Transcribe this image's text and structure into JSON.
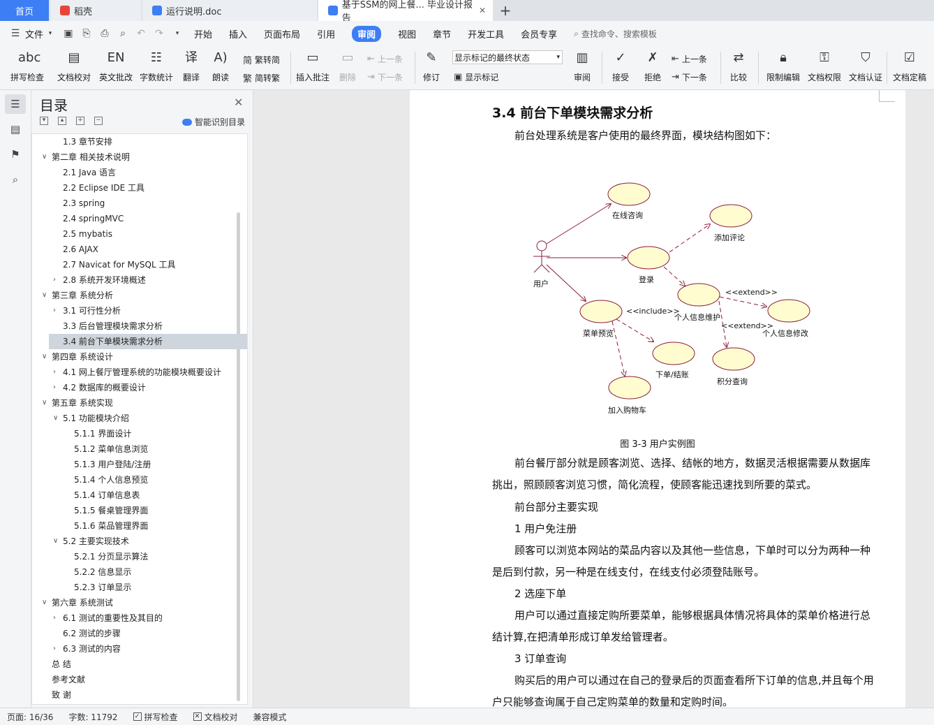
{
  "tabs": {
    "home": "首页",
    "t1": "稻壳",
    "t2": "运行说明.doc",
    "t3": "基于SSM的网上餐... 毕业设计报告",
    "plus": "+"
  },
  "menu": {
    "file": "文件",
    "items": [
      "开始",
      "插入",
      "页面布局",
      "引用",
      "审阅",
      "视图",
      "章节",
      "开发工具",
      "会员专享"
    ],
    "active": "审阅",
    "search": "查找命令、搜索模板"
  },
  "ribbon": {
    "spell": "拼写检查",
    "proof": "文档校对",
    "en": "英文批改",
    "count": "字数统计",
    "translate": "翻译",
    "read": "朗读",
    "trad": "繁转简",
    "simp": "简转繁",
    "insert_comment": "插入批注",
    "delete": "删除",
    "prev": "上一条",
    "next": "下一条",
    "revise": "修订",
    "markup_state": "显示标记的最终状态",
    "show_markup": "显示标记",
    "review": "审阅",
    "accept": "接受",
    "reject": "拒绝",
    "prev2": "上一条",
    "next2": "下一条",
    "compare": "比较",
    "restrict": "限制编辑",
    "perm": "文档权限",
    "auth": "文档认证",
    "final": "文档定稿"
  },
  "toc": {
    "title": "目录",
    "smart": "智能识别目录",
    "items": [
      {
        "text": "1.3 章节安排",
        "level": 2,
        "caret": ""
      },
      {
        "text": "第二章  相关技术说明",
        "level": 1,
        "caret": "v"
      },
      {
        "text": "2.1 Java 语言",
        "level": 2,
        "caret": ""
      },
      {
        "text": "2.2 Eclipse IDE 工具",
        "level": 2,
        "caret": ""
      },
      {
        "text": "2.3 spring",
        "level": 2,
        "caret": ""
      },
      {
        "text": "2.4 springMVC",
        "level": 2,
        "caret": ""
      },
      {
        "text": "2.5 mybatis",
        "level": 2,
        "caret": ""
      },
      {
        "text": "2.6 AJAX",
        "level": 2,
        "caret": ""
      },
      {
        "text": "2.7 Navicat for MySQL 工具",
        "level": 2,
        "caret": ""
      },
      {
        "text": "2.8 系统开发环境概述",
        "level": 2,
        "caret": ">"
      },
      {
        "text": "第三章  系统分析",
        "level": 1,
        "caret": "v"
      },
      {
        "text": "3.1 可行性分析",
        "level": 2,
        "caret": ">"
      },
      {
        "text": "3.3 后台管理模块需求分析",
        "level": 2,
        "caret": ""
      },
      {
        "text": "3.4 前台下单模块需求分析",
        "level": 2,
        "caret": "",
        "selected": true
      },
      {
        "text": "第四章  系统设计",
        "level": 1,
        "caret": "v"
      },
      {
        "text": "4.1 网上餐厅管理系统的功能模块概要设计",
        "level": 2,
        "caret": ">"
      },
      {
        "text": "4.2 数据库的概要设计",
        "level": 2,
        "caret": ">"
      },
      {
        "text": "第五章  系统实现",
        "level": 1,
        "caret": "v"
      },
      {
        "text": "5.1 功能模块介绍",
        "level": 2,
        "caret": "v"
      },
      {
        "text": "5.1.1 界面设计",
        "level": 3,
        "caret": ""
      },
      {
        "text": "5.1.2  菜单信息浏览",
        "level": 3,
        "caret": ""
      },
      {
        "text": "5.1.3  用户登陆/注册",
        "level": 3,
        "caret": ""
      },
      {
        "text": "5.1.4  个人信息预览",
        "level": 3,
        "caret": ""
      },
      {
        "text": "5.1.4  订单信息表",
        "level": 3,
        "caret": ""
      },
      {
        "text": "5.1.5  餐桌管理界面",
        "level": 3,
        "caret": ""
      },
      {
        "text": "5.1.6  菜品管理界面",
        "level": 3,
        "caret": ""
      },
      {
        "text": "5.2 主要实现技术",
        "level": 2,
        "caret": "v"
      },
      {
        "text": "5.2.1 分页显示算法",
        "level": 3,
        "caret": ""
      },
      {
        "text": "5.2.2  信息显示",
        "level": 3,
        "caret": ""
      },
      {
        "text": "5.2.3  订单显示",
        "level": 3,
        "caret": ""
      },
      {
        "text": "第六章  系统测试",
        "level": 1,
        "caret": "v"
      },
      {
        "text": "6.1 测试的重要性及其目的",
        "level": 2,
        "caret": ">"
      },
      {
        "text": "6.2 测试的步骤",
        "level": 2,
        "caret": ""
      },
      {
        "text": "6.3 测试的内容",
        "level": 2,
        "caret": ">"
      },
      {
        "text": "总    结",
        "level": 1,
        "caret": ""
      },
      {
        "text": "参考文献",
        "level": 1,
        "caret": ""
      },
      {
        "text": "致    谢",
        "level": 1,
        "caret": ""
      }
    ]
  },
  "doc": {
    "heading": "3.4 前台下单模块需求分析",
    "intro": "前台处理系统是客户使用的最终界面，模块结构图如下：",
    "caption": "图 3-3  用户实例图",
    "diagram": {
      "actor": "用户",
      "online": "在线咨询",
      "comment": "添加评论",
      "login": "登录",
      "info": "个人信息维护",
      "modify": "个人信息修改",
      "menu": "菜单预览",
      "order": "下单/结账",
      "points": "积分查询",
      "cart": "加入购物车",
      "include": "<<include>>",
      "extend1": "<<extend>>",
      "extend2": "<<extend>>"
    },
    "p1": "前台餐厅部分就是顾客浏览、选择、结帐的地方，数据灵活根据需要从数据库挑出，照顾顾客浏览习惯，简化流程，使顾客能迅速找到所要的菜式。",
    "p2": "前台部分主要实现",
    "p3": "1  用户免注册",
    "p4": "顾客可以浏览本网站的菜品内容以及其他一些信息，下单时可以分为两种一种是后到付款，另一种是在线支付，在线支付必须登陆账号。",
    "p5": "2  选座下单",
    "p6": "用户可以通过直接定购所要菜单，能够根据具体情况将具体的菜单价格进行总结计算,在把清单形成订单发给管理者。",
    "p7": "3  订单查询",
    "p8": "购买后的用户可以通过在自己的登录后的页面查看所下订单的信息,并且每个用户只能够查询属于自己定购菜单的数量和定购时间。"
  },
  "status": {
    "page": "页面: 16/36",
    "words": "字数: 11792",
    "spell": "拼写检查",
    "proof": "文档校对",
    "compat": "兼容模式"
  }
}
